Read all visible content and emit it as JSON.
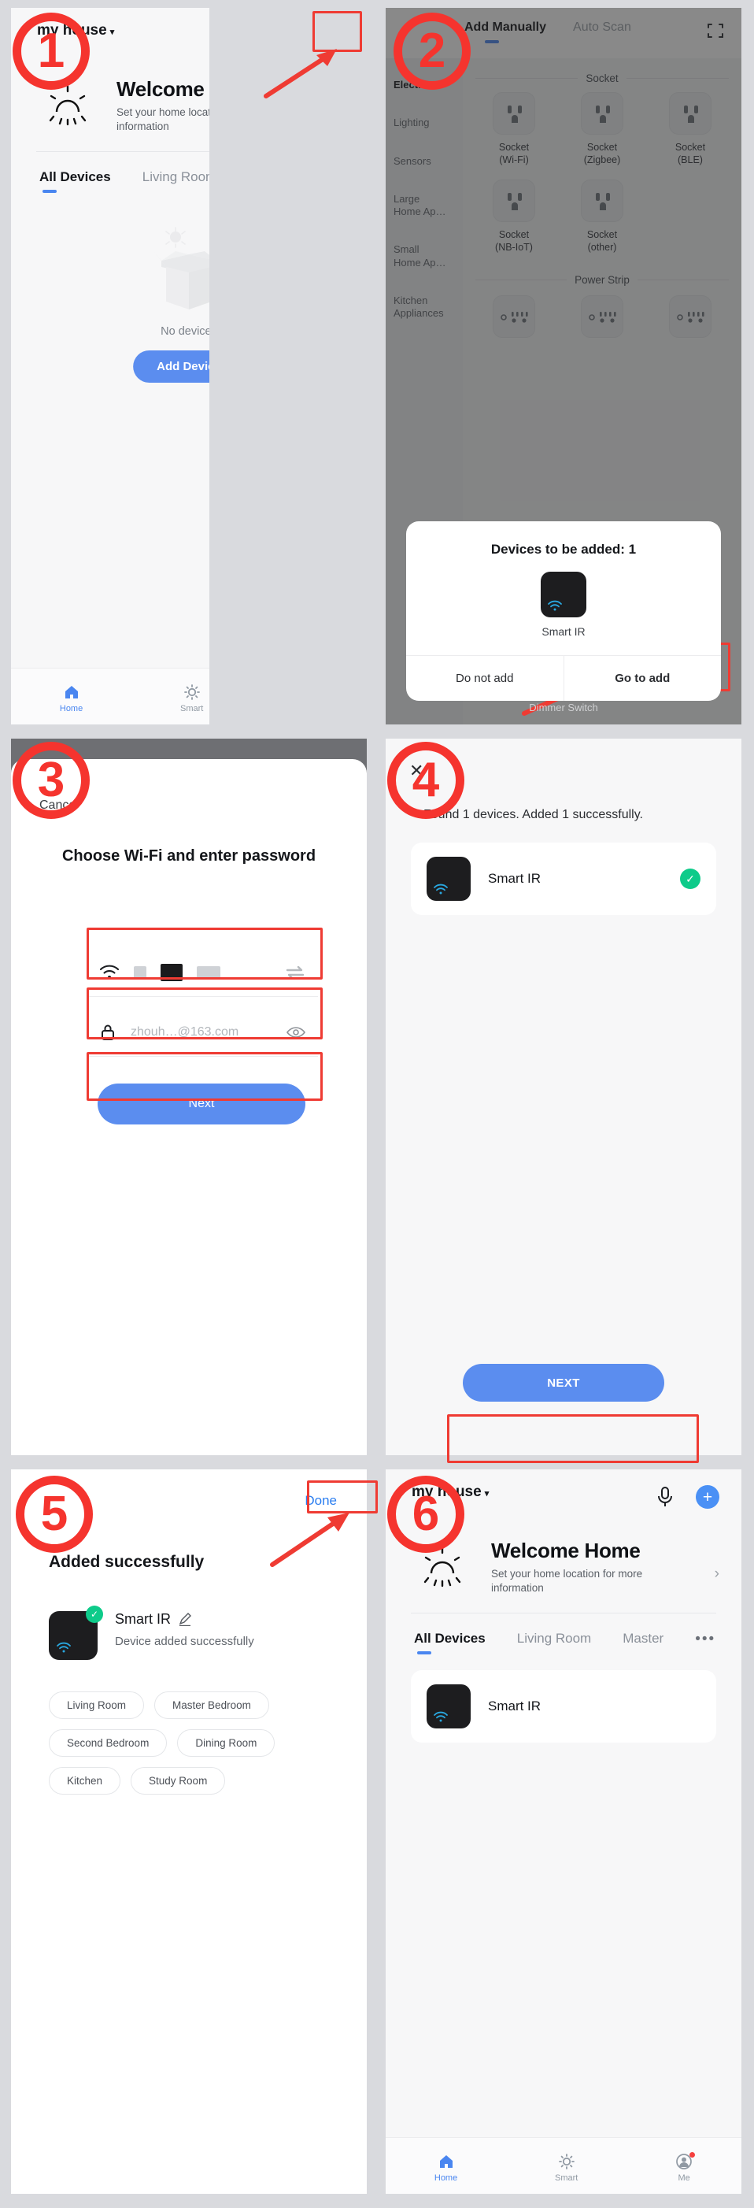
{
  "home": {
    "home_name": "my house",
    "caret": "▾",
    "mic_icon": "microphone-icon",
    "plus_label": "+",
    "welcome_title": "Welcome Home",
    "welcome_sub": "Set your home location for more information",
    "chevron": "›",
    "tabs": [
      {
        "label": "All Devices",
        "active": true
      },
      {
        "label": "Living Room",
        "active": false
      },
      {
        "label": "Master",
        "active": false
      }
    ],
    "tab_more": "•••",
    "empty": {
      "no_devices": "No devices",
      "add_device": "Add Device"
    },
    "device": {
      "name": "Smart IR"
    },
    "nav": [
      {
        "label": "Home",
        "icon": "home-icon",
        "active": true,
        "dot": false
      },
      {
        "label": "Smart",
        "icon": "smart-icon",
        "active": false,
        "dot": false
      },
      {
        "label": "Me",
        "icon": "profile-icon",
        "active": false,
        "dot": true
      }
    ]
  },
  "add_manually": {
    "back": "‹",
    "tabs": [
      {
        "label": "Add Manually",
        "active": true
      },
      {
        "label": "Auto Scan",
        "active": false
      }
    ],
    "scan_icon": "scan-frame-icon",
    "categories": [
      {
        "label": "Electrical",
        "active": true
      },
      {
        "label": "Lighting",
        "active": false
      },
      {
        "label": "Sensors",
        "active": false
      },
      {
        "label": "Large\nHome Ap…",
        "active": false
      },
      {
        "label": "Small\nHome Ap…",
        "active": false
      },
      {
        "label": "Kitchen\nAppliances",
        "active": false
      }
    ],
    "sections": [
      {
        "title": "Socket",
        "items": [
          {
            "label": "Socket\n(Wi-Fi)",
            "icon": "socket-icon"
          },
          {
            "label": "Socket\n(Zigbee)",
            "icon": "socket-icon"
          },
          {
            "label": "Socket\n(BLE)",
            "icon": "socket-icon"
          },
          {
            "label": "Socket\n(NB-IoT)",
            "icon": "socket-icon"
          },
          {
            "label": "Socket\n(other)",
            "icon": "socket-icon"
          }
        ]
      },
      {
        "title": "Power Strip",
        "items": [
          {
            "label": "",
            "icon": "power-strip-icon"
          },
          {
            "label": "",
            "icon": "power-strip-icon"
          },
          {
            "label": "",
            "icon": "power-strip-icon"
          }
        ]
      }
    ],
    "footer_hint": "Dimmer Switch",
    "dialog": {
      "title": "Devices to be added: 1",
      "device_name": "Smart IR",
      "cancel_label": "Do not add",
      "confirm_label": "Go to add"
    }
  },
  "wifi": {
    "cancel": "Cance",
    "title": "Choose Wi-Fi and enter password",
    "ssid_icon": "wifi-icon",
    "ssid_value": "",
    "switch_icon": "switch-network-icon",
    "lock_icon": "lock-icon",
    "password_value": "zhouh…@163.com",
    "eye_icon": "eye-icon",
    "next_label": "Next"
  },
  "added": {
    "close": "✕",
    "message": "Found 1 devices. Added 1 successfully.",
    "device_name": "Smart IR",
    "check_icon": "check-circle-icon",
    "next_label": "NEXT"
  },
  "success": {
    "done_label": "Done",
    "title": "Added successfully",
    "device_name": "Smart IR",
    "edit_icon": "pencil-icon",
    "device_sub": "Device added successfully",
    "rooms": [
      "Living Room",
      "Master Bedroom",
      "Second Bedroom",
      "Dining Room",
      "Kitchen",
      "Study Room"
    ]
  },
  "annotations": {
    "steps": [
      "1",
      "2",
      "3",
      "4",
      "5",
      "6"
    ],
    "accent_red": "#f5342e",
    "accent_blue": "#4a86f0"
  }
}
